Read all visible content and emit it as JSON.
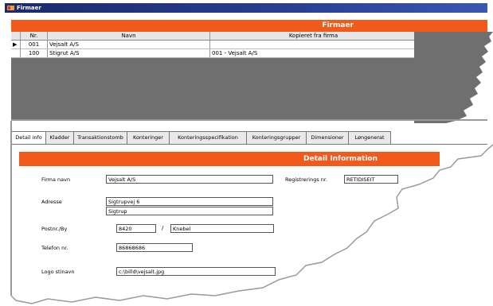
{
  "window": {
    "title": "Firmaer"
  },
  "header": {
    "label": "Firmaer"
  },
  "grid": {
    "columns": [
      "Nr.",
      "Navn",
      "Kopieret fra firma"
    ],
    "rows": [
      {
        "selector": "▶",
        "nr": "001",
        "navn": "Vejsalt A/S",
        "kopieret": ""
      },
      {
        "selector": "",
        "nr": "100",
        "navn": "Stigrut A/S",
        "kopieret": "001 - Vejsalt A/S"
      }
    ]
  },
  "tabs": [
    "Detail info",
    "Kladder",
    "Transaktionstomb",
    "Konteringer",
    "Konteringsspecifikation",
    "Konteringsgrupper",
    "Dimensioner",
    "Løngenerat"
  ],
  "detail": {
    "header": "Detail Information",
    "labels": {
      "firmanavn": "Firma navn",
      "adresse": "Adresse",
      "postnr_by": "Postnr./By",
      "telefon": "Telefon nr.",
      "logo": "Logo stinavn",
      "registrering": "Registrerings nr."
    },
    "values": {
      "firmanavn": "Vejsalt A/S",
      "adresse1": "Sigtrupvej 6",
      "adresse2": "Sigtrup",
      "postnr": "8420",
      "by": "Knebel",
      "telefon": "86868686",
      "logo": "c:\\billd\\vejsalt.jpg",
      "registrering": "RETIDISEIT"
    },
    "slash": "/"
  },
  "colors": {
    "accent": "#f25a1c",
    "titlebar": "#1b2a6b",
    "grid_bg": "#6f6f6f"
  }
}
